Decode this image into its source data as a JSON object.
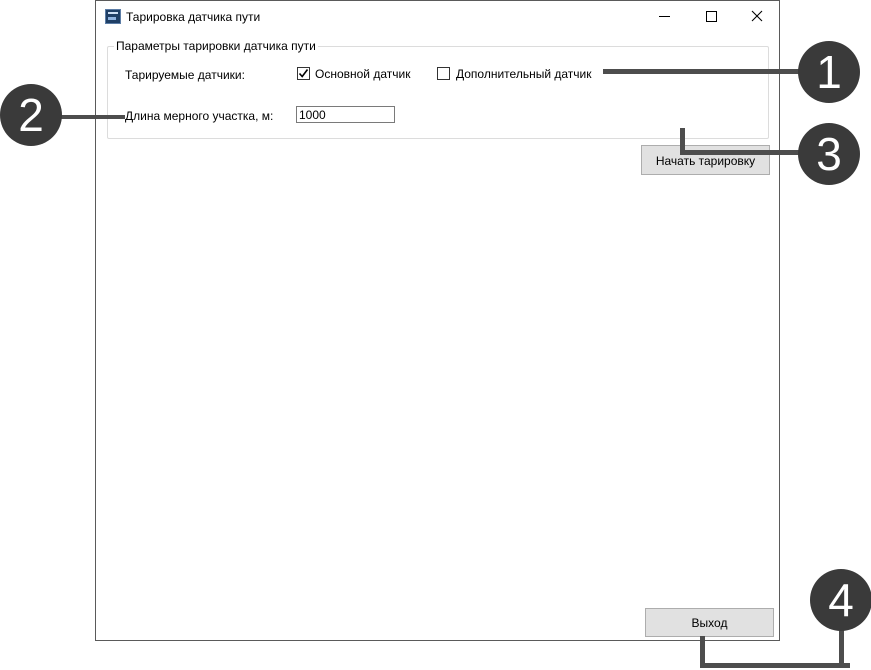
{
  "window": {
    "title": "Тарировка датчика пути",
    "controls": {
      "minimize": "minimize-icon",
      "maximize": "maximize-icon",
      "close": "close-icon"
    }
  },
  "group": {
    "legend": "Параметры тарировки датчика пути",
    "sensors_label": "Тарируемые датчики:",
    "main_sensor": {
      "label": "Основной датчик",
      "checked": true
    },
    "extra_sensor": {
      "label": "Дополнительный датчик",
      "checked": false
    },
    "length_label": "Длина мерного участка, м:",
    "length_value": "1000",
    "start_button": "Начать тарировку"
  },
  "exit_button": "Выход",
  "callouts": [
    "1",
    "2",
    "3",
    "4"
  ],
  "colors": {
    "callout": "#3a3a3a",
    "button_bg": "#e1e1e1",
    "window_border": "#5a5a5a"
  }
}
